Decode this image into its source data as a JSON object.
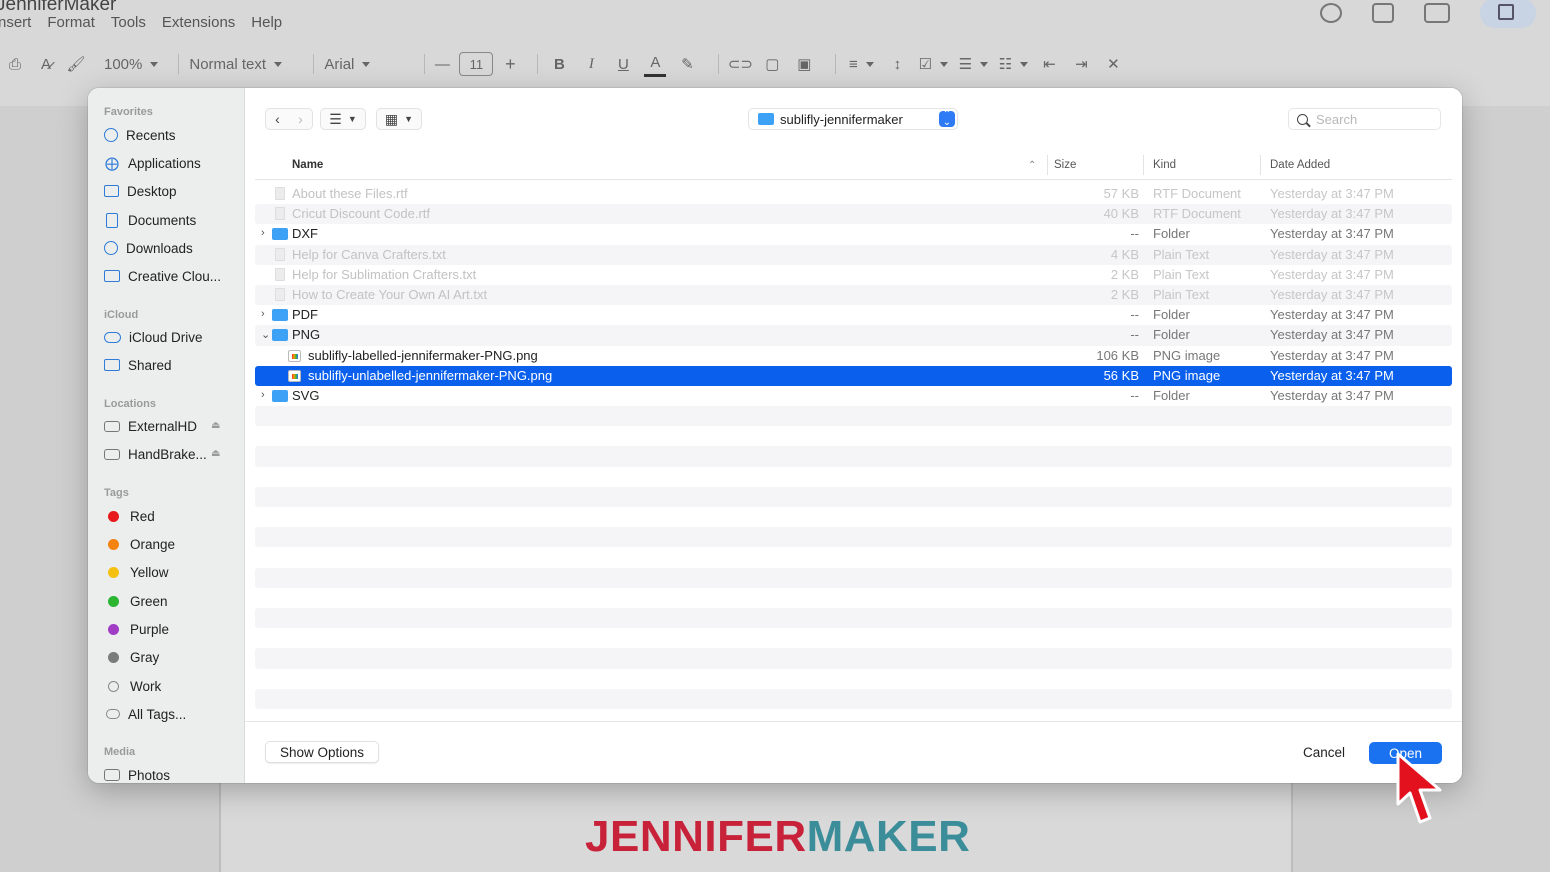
{
  "app": {
    "doc_title": "JenniferMaker",
    "menu": [
      "Insert",
      "Format",
      "Tools",
      "Extensions",
      "Help"
    ],
    "menu_display": [
      "nsert",
      "Format",
      "Tools",
      "Extensions",
      "Help"
    ],
    "toolbar": {
      "zoom": "100%",
      "style": "Normal text",
      "font": "Arial",
      "font_size": "11",
      "minus": "—",
      "plus": "+",
      "bold": "B",
      "italic": "I",
      "underline": "U",
      "text_color": "A"
    }
  },
  "dialog": {
    "sidebar": {
      "favorites_label": "Favorites",
      "favorites": [
        "Recents",
        "Applications",
        "Desktop",
        "Documents",
        "Downloads",
        "Creative Clou..."
      ],
      "icloud_label": "iCloud",
      "icloud": [
        "iCloud Drive",
        "Shared"
      ],
      "locations_label": "Locations",
      "locations": [
        "ExternalHD",
        "HandBrake..."
      ],
      "tags_label": "Tags",
      "tags": [
        {
          "name": "Red",
          "color": "#e8191c"
        },
        {
          "name": "Orange",
          "color": "#f58311"
        },
        {
          "name": "Yellow",
          "color": "#f4c012"
        },
        {
          "name": "Green",
          "color": "#2bb530"
        },
        {
          "name": "Purple",
          "color": "#a13cc4"
        },
        {
          "name": "Gray",
          "color": "#7b7b7b"
        },
        {
          "name": "Work",
          "color": ""
        },
        {
          "name": "All Tags...",
          "color": ""
        }
      ],
      "media_label": "Media",
      "media": [
        "Photos"
      ]
    },
    "toolbar": {
      "back_icon": "chevron-left-icon",
      "forward_icon": "chevron-right-icon",
      "path": "sublifly-jennifermaker",
      "search_placeholder": "Search"
    },
    "columns": {
      "name": "Name",
      "size": "Size",
      "kind": "Kind",
      "date": "Date Added"
    },
    "rows": [
      {
        "name": "About these Files.rtf",
        "size": "57 KB",
        "kind": "RTF Document",
        "date": "Yesterday at 3:47 PM",
        "type": "doc",
        "state": "dim"
      },
      {
        "name": "Cricut Discount Code.rtf",
        "size": "40 KB",
        "kind": "RTF Document",
        "date": "Yesterday at 3:47 PM",
        "type": "doc",
        "state": "dim"
      },
      {
        "name": "DXF",
        "size": "--",
        "kind": "Folder",
        "date": "Yesterday at 3:47 PM",
        "type": "folder",
        "state": "collapsed"
      },
      {
        "name": "Help for Canva Crafters.txt",
        "size": "4 KB",
        "kind": "Plain Text",
        "date": "Yesterday at 3:47 PM",
        "type": "doc",
        "state": "dim"
      },
      {
        "name": "Help for Sublimation Crafters.txt",
        "size": "2 KB",
        "kind": "Plain Text",
        "date": "Yesterday at 3:47 PM",
        "type": "doc",
        "state": "dim"
      },
      {
        "name": "How to Create Your Own AI Art.txt",
        "size": "2 KB",
        "kind": "Plain Text",
        "date": "Yesterday at 3:47 PM",
        "type": "doc",
        "state": "dim"
      },
      {
        "name": "PDF",
        "size": "--",
        "kind": "Folder",
        "date": "Yesterday at 3:47 PM",
        "type": "folder",
        "state": "collapsed"
      },
      {
        "name": "PNG",
        "size": "--",
        "kind": "Folder",
        "date": "Yesterday at 3:47 PM",
        "type": "folder",
        "state": "expanded"
      },
      {
        "name": "sublifly-labelled-jennifermaker-PNG.png",
        "size": "106 KB",
        "kind": "PNG image",
        "date": "Yesterday at 3:47 PM",
        "type": "png",
        "state": "normal"
      },
      {
        "name": "sublifly-unlabelled-jennifermaker-PNG.png",
        "size": "56 KB",
        "kind": "PNG image",
        "date": "Yesterday at 3:47 PM",
        "type": "png",
        "state": "selected"
      },
      {
        "name": "SVG",
        "size": "--",
        "kind": "Folder",
        "date": "Yesterday at 3:47 PM",
        "type": "folder",
        "state": "collapsed"
      }
    ],
    "footer": {
      "show_options": "Show Options",
      "cancel": "Cancel",
      "open": "Open"
    }
  },
  "branding": {
    "logo_part1": "JENNIFER",
    "logo_part2": "MAKER",
    "color1": "#c8213a",
    "color2": "#3b8d99"
  }
}
